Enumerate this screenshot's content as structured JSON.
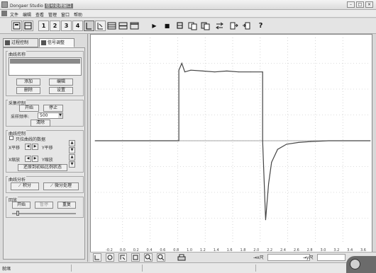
{
  "window": {
    "title": "Dongaer Studio",
    "title_highlight": "信号处理窗口",
    "controls": {
      "minimize": "–",
      "maximize": "□",
      "close": "×"
    }
  },
  "menu": {
    "items": [
      "文件",
      "编辑",
      "查看",
      "管理",
      "窗口",
      "帮助"
    ]
  },
  "toolbar": {
    "numbered": [
      "1",
      "2",
      "3",
      "4"
    ],
    "icons": [
      "open-icon",
      "save-icon",
      "select-icon",
      "cursor-icon",
      "layout-icon",
      "split-h-icon",
      "split-v-icon",
      "play-icon",
      "stop-icon",
      "record-icon",
      "copy-icon",
      "paste-icon",
      "swap-icon",
      "export-icon",
      "import-icon",
      "help-icon"
    ],
    "help_label": "?",
    "play_glyph": "▶",
    "stop_glyph": "■"
  },
  "sidebar": {
    "tabs": [
      {
        "label": "过程控制"
      },
      {
        "label": "信号调整"
      }
    ],
    "curve_group": {
      "title": "曲线名称",
      "buttons": [
        "添加",
        "删除",
        "编辑",
        "设置"
      ]
    },
    "sampling_group": {
      "title": "采集控制",
      "start_button": "开始",
      "stop_button": "停止",
      "rate_label": "采样频率:",
      "rate_value": "500",
      "clear_button": "清除"
    },
    "curve_control_group": {
      "title": "曲线控制",
      "checkbox_label": "只拉曲线的数据",
      "x_label": "X平移",
      "y_label": "Y平移",
      "x_scale_label": "X缩放",
      "y_scale_label": "Y缩放",
      "restore_button": "还原到初始比例状态"
    },
    "analysis_group": {
      "title": "曲线分析",
      "btn_left": "积分",
      "btn_right": "微分处理"
    },
    "replay_group": {
      "title": "回放",
      "buttons": [
        "开始",
        "暂停",
        "重复"
      ]
    }
  },
  "bottombar": {
    "icons": [
      "zoom-in-icon",
      "zoom-out-icon",
      "pan-icon",
      "fit-icon",
      "zoom-x-icon",
      "zoom-y-icon",
      "print-icon"
    ],
    "ruler1_label": "x尺",
    "ruler2_label": "y尺"
  },
  "statusbar": {
    "text": "就绪"
  },
  "chart_data": {
    "type": "line",
    "x_ticks": [
      "-0.2",
      "0.0",
      "0.2",
      "0.4",
      "0.6",
      "0.8",
      "1.0",
      "1.2",
      "1.4",
      "1.6",
      "1.8",
      "2.0",
      "2.2",
      "2.4",
      "2.6",
      "2.8",
      "3.0",
      "3.2",
      "3.4",
      "3.6"
    ],
    "xlim": [
      -0.6,
      4.0
    ],
    "ylim": [
      -1.2,
      1.2
    ],
    "grid": true,
    "series": [
      {
        "color": "#444444",
        "x": [
          -0.6,
          0.8,
          0.8,
          0.85,
          0.9,
          1.0,
          1.2,
          1.4,
          1.6,
          1.8,
          2.0,
          2.2,
          2.2,
          2.25,
          2.3,
          2.35,
          2.45,
          2.6,
          2.8,
          3.0,
          3.3,
          4.0
        ],
        "y": [
          0.0,
          0.0,
          0.82,
          0.9,
          0.8,
          0.82,
          0.81,
          0.8,
          0.81,
          0.8,
          0.8,
          0.8,
          0.0,
          -0.92,
          -0.5,
          -0.25,
          -0.1,
          -0.04,
          -0.02,
          -0.01,
          0.0,
          0.0
        ]
      }
    ]
  }
}
